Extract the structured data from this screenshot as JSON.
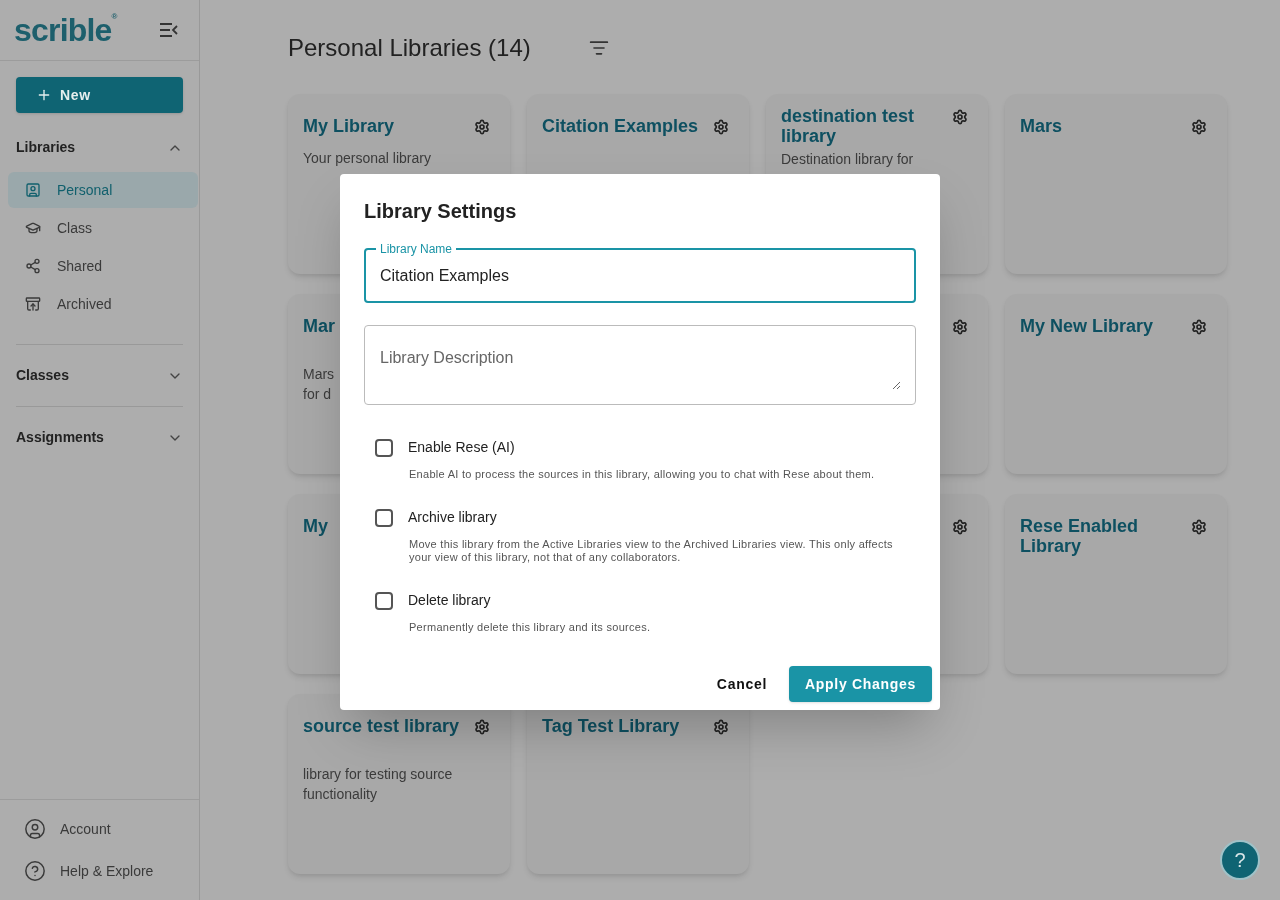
{
  "sidebar": {
    "logo": "scrible",
    "logo_mark": "®",
    "new_button": "New",
    "sections": [
      {
        "title": "Libraries",
        "expanded": true,
        "items": [
          {
            "label": "Personal",
            "selected": true
          },
          {
            "label": "Class",
            "selected": false
          },
          {
            "label": "Shared",
            "selected": false
          },
          {
            "label": "Archived",
            "selected": false
          }
        ]
      },
      {
        "title": "Classes",
        "expanded": false
      },
      {
        "title": "Assignments",
        "expanded": false
      }
    ],
    "footer": [
      "Account",
      "Help & Explore"
    ]
  },
  "main": {
    "title": "Personal Libraries (14)",
    "cards": [
      {
        "kind": "card",
        "title": "My Library",
        "description": "Your personal library"
      },
      {
        "kind": "card",
        "title": "Citation Examples"
      },
      {
        "kind": "card",
        "title": "destination test library",
        "description": "Destination library for"
      },
      {
        "kind": "card",
        "title": "Mars"
      },
      {
        "kind": "edge",
        "title": "Mar",
        "description": "Mars\nfor d"
      },
      {
        "kind": "covered"
      },
      {
        "kind": "card"
      },
      {
        "kind": "card",
        "title": "My New Library"
      },
      {
        "kind": "edge",
        "title": "My"
      },
      {
        "kind": "covered"
      },
      {
        "kind": "card"
      },
      {
        "kind": "card",
        "title": "Rese Enabled Library"
      },
      {
        "kind": "card",
        "title": "source test library",
        "description": "library for testing source functionality"
      },
      {
        "kind": "card",
        "title": "Tag Test Library"
      }
    ]
  },
  "dialog": {
    "title": "Library Settings",
    "name_field": {
      "label": "Library Name",
      "value": "Citation Examples"
    },
    "description_field": {
      "placeholder": "Library Description"
    },
    "options": [
      {
        "label": "Enable Rese (AI)",
        "description": "Enable AI to process the sources in this library, allowing you to chat with Rese about them.",
        "checked": false
      },
      {
        "label": "Archive library",
        "description": "Move this library from the Active Libraries view to the Archived Libraries view. This only affects your view of this library, not that of any collaborators.",
        "checked": false
      },
      {
        "label": "Delete library",
        "description": "Permanently delete this library and its sources.",
        "checked": false
      }
    ],
    "buttons": [
      {
        "label": "Cancel",
        "kind": "text"
      },
      {
        "label": "Apply Changes",
        "kind": "primary"
      }
    ]
  },
  "help_button": "?"
}
